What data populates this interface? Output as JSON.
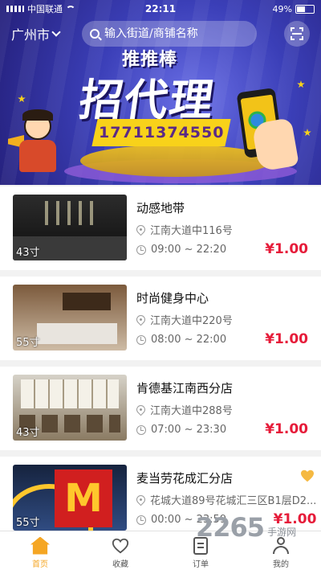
{
  "status_bar": {
    "carrier": "中国联通",
    "time": "22:11",
    "battery": "49%"
  },
  "header": {
    "city": "广州市",
    "search_placeholder": "输入街道/商铺名称"
  },
  "banner": {
    "top_text": "推推棒",
    "main_text": "招代理",
    "phone": "17711374550"
  },
  "shops": [
    {
      "name": "动感地带",
      "size": "43寸",
      "address": "江南大道中116号",
      "hours": "09:00 ~ 22:20",
      "price": "¥1.00",
      "favorited": false
    },
    {
      "name": "时尚健身中心",
      "size": "55寸",
      "address": "江南大道中220号",
      "hours": "08:00 ~ 22:00",
      "price": "¥1.00",
      "favorited": false
    },
    {
      "name": "肯德基江南西分店",
      "size": "43寸",
      "address": "江南大道中288号",
      "hours": "07:00 ~ 23:30",
      "price": "¥1.00",
      "favorited": false
    },
    {
      "name": "麦当劳花成汇分店",
      "size": "55寸",
      "address": "花城大道89号花城汇三区B1层D2...",
      "hours": "00:00 ~ 23:59",
      "price": "¥1.00",
      "favorited": true
    }
  ],
  "tabbar": {
    "home": "首页",
    "favorites": "收藏",
    "orders": "订单",
    "me": "我的"
  },
  "watermark": {
    "number": "2265",
    "site": "手游网"
  },
  "colors": {
    "accent": "#f5a623",
    "price": "#e61c3a",
    "banner_bg": "#3b3fb8"
  }
}
